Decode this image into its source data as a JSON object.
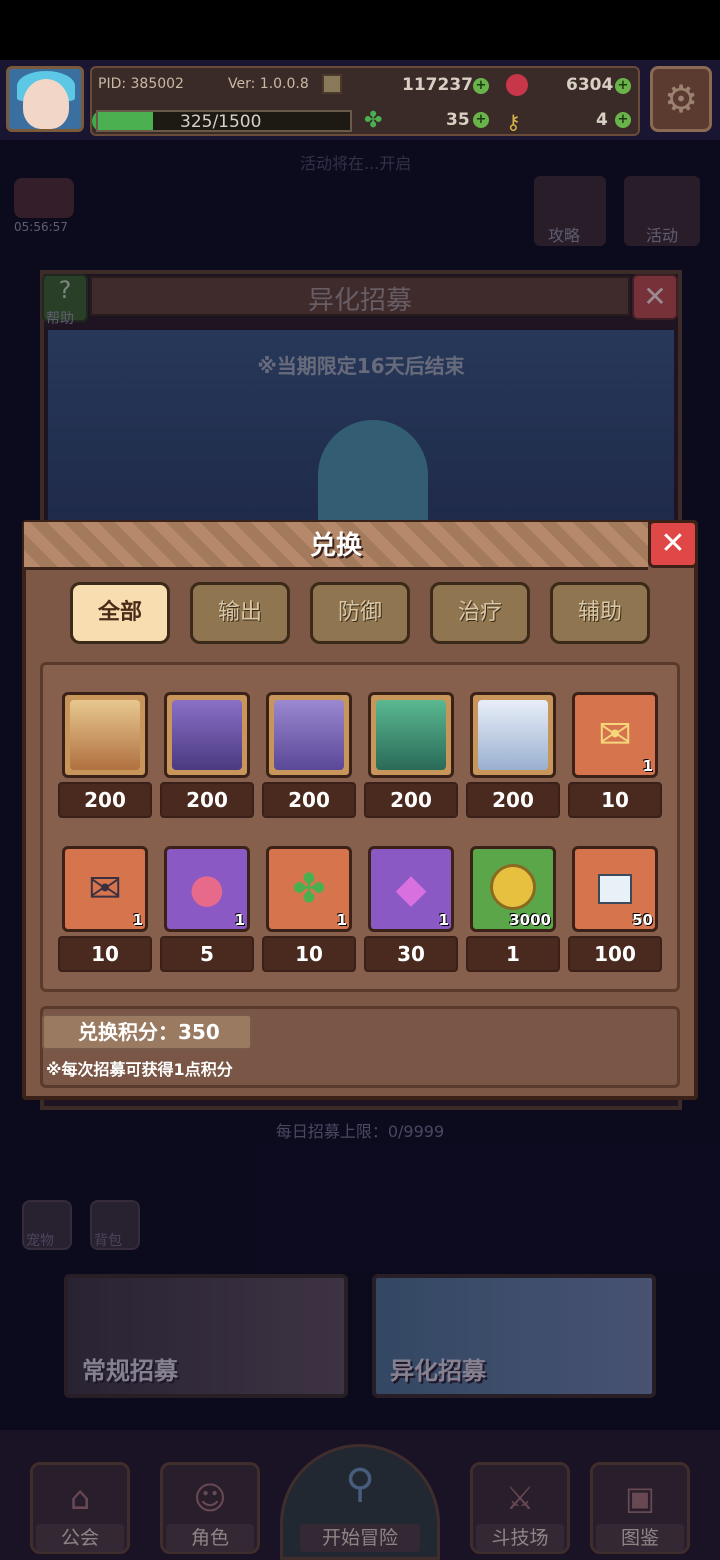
{
  "hud": {
    "pid": "PID: 385002",
    "version": "Ver: 1.0.0.8",
    "gold": "117237",
    "gems": "6304",
    "xp": "325/1500",
    "xp_fraction": 0.2167,
    "clover": "35",
    "keys": "4"
  },
  "background": {
    "timer": "05:56:57",
    "faded_banner": "活动将在...开启",
    "guide_label": "攻略",
    "event_label": "活动",
    "panel_title": "异化招募",
    "help_label": "帮助",
    "limited_notice": "※当期限定16天后结束",
    "daily_limit": "每日招募上限：0/9999",
    "side_btn1": "宠物",
    "side_btn2": "背包"
  },
  "modal": {
    "title": "兑换",
    "tabs": [
      {
        "label": "全部",
        "active": true
      },
      {
        "label": "输出",
        "active": false
      },
      {
        "label": "防御",
        "active": false
      },
      {
        "label": "治疗",
        "active": false
      },
      {
        "label": "辅助",
        "active": false
      }
    ],
    "items": [
      {
        "icon": "blonde-hero-portrait",
        "qty": "",
        "price": "200"
      },
      {
        "icon": "purple-hair-hero-portrait",
        "qty": "",
        "price": "200"
      },
      {
        "icon": "violet-hero-portrait",
        "qty": "",
        "price": "200"
      },
      {
        "icon": "green-hair-hero-portrait",
        "qty": "",
        "price": "200"
      },
      {
        "icon": "white-hair-hero-portrait",
        "qty": "",
        "price": "200"
      },
      {
        "icon": "heart-letter-icon",
        "qty": "1",
        "price": "10"
      },
      {
        "icon": "dark-letter-icon",
        "qty": "1",
        "price": "10"
      },
      {
        "icon": "pink-fruit-icon",
        "qty": "1",
        "price": "5"
      },
      {
        "icon": "four-leaf-clover-icon",
        "qty": "1",
        "price": "10"
      },
      {
        "icon": "purple-crystal-icon",
        "qty": "1",
        "price": "30"
      },
      {
        "icon": "gold-coin-icon",
        "qty": "3000",
        "price": "1"
      },
      {
        "icon": "puzzle-piece-icon",
        "qty": "50",
        "price": "100"
      }
    ],
    "points_label": "兑换积分：350",
    "note": "※每次招募可获得1点积分"
  },
  "recruit": {
    "normal": "常规招募",
    "special": "异化招募"
  },
  "nav": [
    {
      "label": "公会",
      "icon": "guild-building-icon"
    },
    {
      "label": "角色",
      "icon": "character-icon"
    },
    {
      "label": "开始冒险",
      "icon": "magnifier-icon"
    },
    {
      "label": "斗技场",
      "icon": "crossed-swords-icon"
    },
    {
      "label": "图鉴",
      "icon": "codex-icon"
    }
  ]
}
